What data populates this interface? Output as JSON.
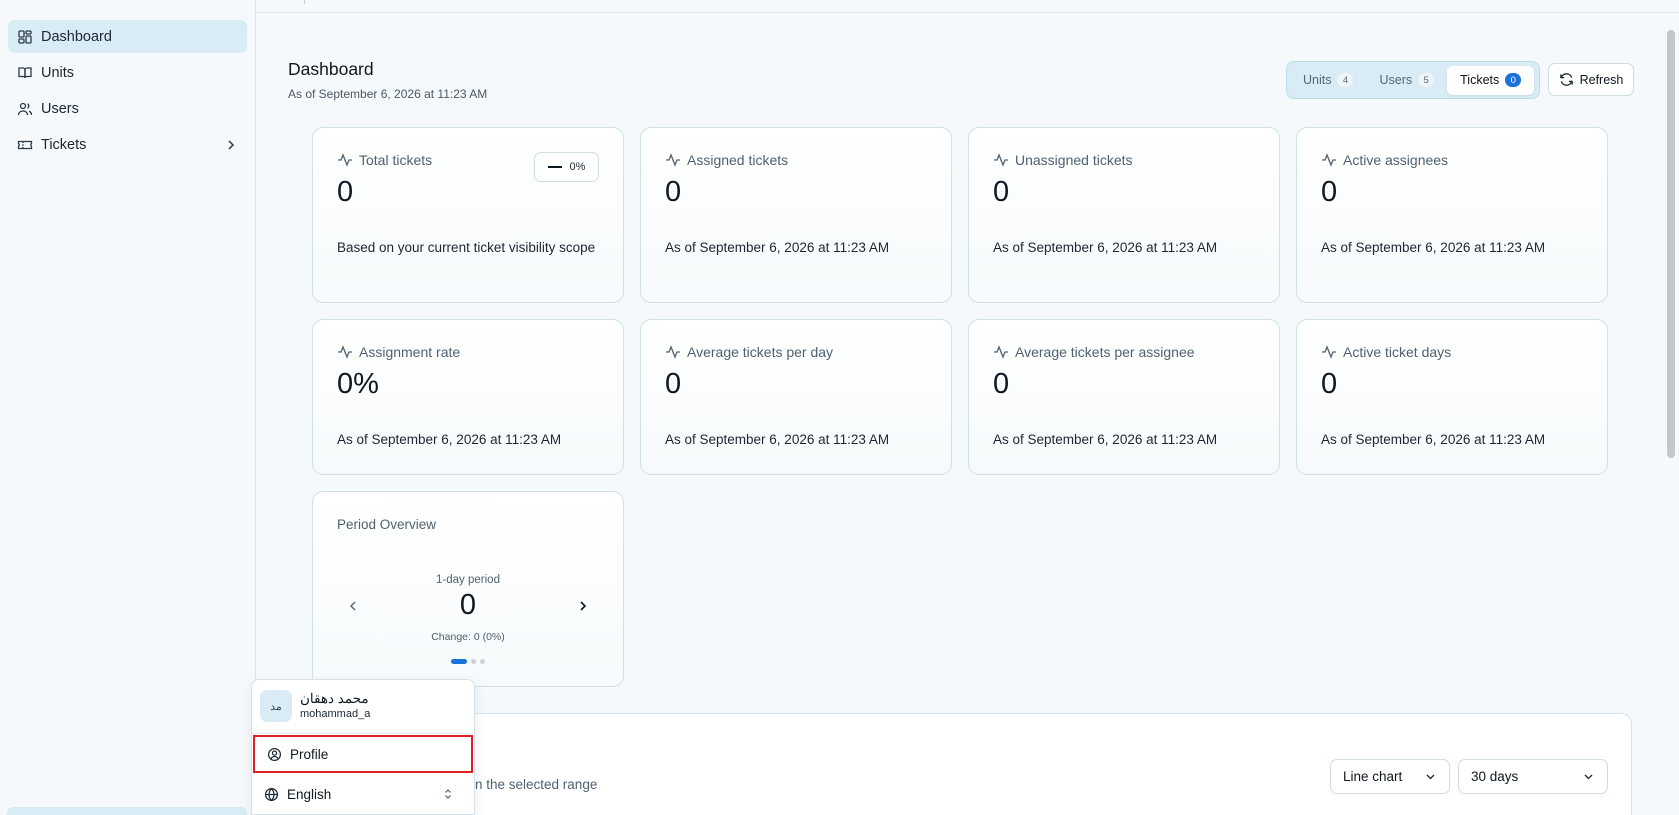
{
  "sidebar": {
    "items": [
      {
        "label": "Dashboard",
        "icon": "dashboard-icon",
        "active": true
      },
      {
        "label": "Units",
        "icon": "book-icon"
      },
      {
        "label": "Users",
        "icon": "users-icon"
      },
      {
        "label": "Tickets",
        "icon": "ticket-icon",
        "has_children": true
      }
    ]
  },
  "header": {
    "title": "Dashboard",
    "subtitle": "As of September 6, 2026 at 11:23 AM",
    "tabs": [
      {
        "label": "Units",
        "count": "4"
      },
      {
        "label": "Users",
        "count": "5"
      },
      {
        "label": "Tickets",
        "count": "0",
        "active": true
      }
    ],
    "refresh_label": "Refresh"
  },
  "cards": [
    {
      "title": "Total tickets",
      "value": "0",
      "foot": "Based on your current ticket visibility scope",
      "change": "0%"
    },
    {
      "title": "Assigned tickets",
      "value": "0",
      "foot": "As of September 6, 2026 at 11:23 AM"
    },
    {
      "title": "Unassigned tickets",
      "value": "0",
      "foot": "As of September 6, 2026 at 11:23 AM"
    },
    {
      "title": "Active assignees",
      "value": "0",
      "foot": "As of September 6, 2026 at 11:23 AM"
    },
    {
      "title": "Assignment rate",
      "value": "0%",
      "foot": "As of September 6, 2026 at 11:23 AM"
    },
    {
      "title": "Average tickets per day",
      "value": "0",
      "foot": "As of September 6, 2026 at 11:23 AM"
    },
    {
      "title": "Average tickets per assignee",
      "value": "0",
      "foot": "As of September 6, 2026 at 11:23 AM"
    },
    {
      "title": "Active ticket days",
      "value": "0",
      "foot": "As of September 6, 2026 at 11:23 AM"
    }
  ],
  "period": {
    "title": "Period Overview",
    "label": "1-day period",
    "value": "0",
    "change": "Change: 0 (0%)"
  },
  "panel": {
    "subtitle": "in the selected range",
    "chart_type": "Line chart",
    "range": "30 days"
  },
  "user_menu": {
    "avatar_initials": "مد",
    "name": "محمد دهقان",
    "handle": "mohammad_a",
    "profile_label": "Profile",
    "language_label": "English"
  },
  "colors": {
    "accent": "#1a73d8",
    "active_bg": "#d9ecf5",
    "highlight": "#e02020"
  }
}
